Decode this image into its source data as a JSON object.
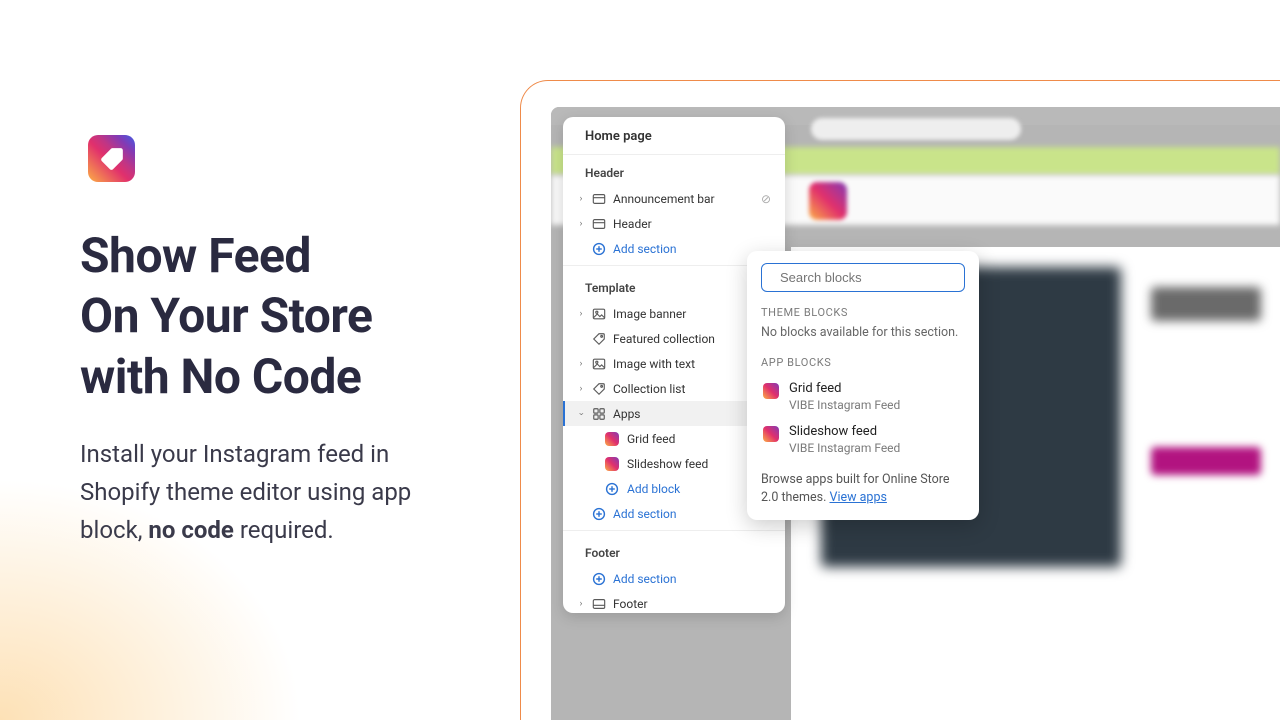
{
  "marketing": {
    "headline_l1": "Show Feed",
    "headline_l2": "On Your Store",
    "headline_l3": "with No Code",
    "sub_pre": "Install your Instagram feed in Shopify theme editor using app block, ",
    "sub_bold": "no code",
    "sub_post": " required."
  },
  "panel": {
    "title": "Home page",
    "groups": {
      "header_label": "Header",
      "template_label": "Template",
      "footer_label": "Footer"
    },
    "header_items": [
      {
        "label": "Announcement bar",
        "hidden": true
      },
      {
        "label": "Header",
        "hidden": false
      }
    ],
    "template_items": [
      {
        "label": "Image banner"
      },
      {
        "label": "Featured collection"
      },
      {
        "label": "Image with text"
      },
      {
        "label": "Collection list"
      },
      {
        "label": "Apps",
        "selected": true,
        "expanded": true
      }
    ],
    "apps_children": [
      {
        "label": "Grid feed"
      },
      {
        "label": "Slideshow feed"
      }
    ],
    "footer_items": [
      {
        "label": "Footer"
      }
    ],
    "add_section": "Add section",
    "add_block": "Add block"
  },
  "popover": {
    "search_placeholder": "Search blocks",
    "theme_blocks_label": "THEME BLOCKS",
    "theme_blocks_empty": "No blocks available for this section.",
    "app_blocks_label": "APP BLOCKS",
    "blocks": [
      {
        "title": "Grid feed",
        "subtitle": "VIBE Instagram Feed"
      },
      {
        "title": "Slideshow feed",
        "subtitle": "VIBE Instagram Feed"
      }
    ],
    "footer_text": "Browse apps built for Online Store 2.0 themes. ",
    "footer_link": "View apps"
  }
}
